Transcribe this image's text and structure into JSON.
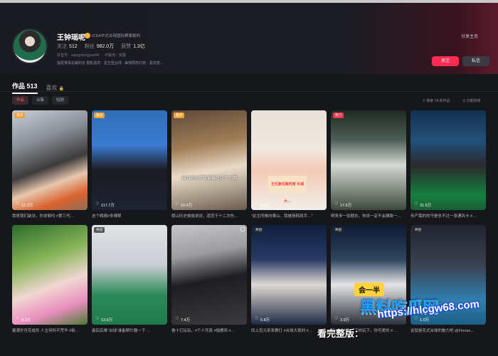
{
  "profile": {
    "name": "王钟瑶呢",
    "verified_text": "ICEA中式台球国际赛事裁判",
    "stats": [
      {
        "label": "关注",
        "value": "512"
      },
      {
        "label": "粉丝",
        "value": "982.0万"
      },
      {
        "label": "获赞",
        "value": "1.3亿"
      }
    ],
    "account_id": "抖音号：wangzhongyao54",
    "ip_location": "IP属地：安徽",
    "bio": "独爱赛事总裁判长 摄影嘉宾 · 星空壹台球 · 美丽照样打枪 · 嘉宾唐…",
    "share_label": "分享主页",
    "follow_label": "关注",
    "message_label": "私信"
  },
  "tabs": {
    "works_label": "作品 513",
    "likes_label": "喜欢",
    "lock_icon": "lock-icon"
  },
  "filters": {
    "chips": [
      "作品",
      "合集",
      "短剧"
    ],
    "search_label": "搜索 TA 的作品",
    "sort_label": "日期排序"
  },
  "videos": [
    {
      "badge": "置顶",
      "likes": "12.3万",
      "caption": "我哥我们敲法，你说够吗 #第三代…"
    },
    {
      "badge": "置顶",
      "likes": "117.7万",
      "caption": "这个姆姆#多裸帮"
    },
    {
      "badge": "置顶",
      "likes": "10.4万",
      "caption": "假山历史偷偷说说，遗恋于十二次伤…",
      "overlay": "自的的东窝背被插在这个上面"
    },
    {
      "badge": "",
      "likes": "2.3万",
      "caption": "\"此生所推向泰山，我摊扬韩就手…\"",
      "overlay": "王氏兼任裁判官 长城大…"
    },
    {
      "badge": "热门",
      "likes": "17.5万",
      "caption": "明来多一张捆去，你说一定不会雅致一…"
    },
    {
      "badge": "",
      "likes": "31.5万",
      "caption": "传产需的的守是总不过一张通风卡 #…"
    },
    {
      "badge": "",
      "likes": "8.2万",
      "caption": "春潮岁月花成形 人生何科不荒华 #新…"
    },
    {
      "badge": "共创",
      "likes": "13.6万",
      "caption": "最后后难\"台球\"谁能帮忙撒一下 …"
    },
    {
      "badge": "",
      "likes": "7.4万",
      "caption": "看十打玩玩。#个人写真 #伽鹿风 #…"
    },
    {
      "badge": "共创",
      "likes": "5.8万",
      "caption": "同上您元来来赛打 #台球大裁判 #…"
    },
    {
      "badge": "共创",
      "likes": "3.9万",
      "caption": "终于和他约好了你玩下，你可爱的 # …"
    },
    {
      "badge": "共创",
      "likes": "1.0万",
      "caption": "这就是花式台球的魅力吧 @Florian…"
    }
  ],
  "watermark": {
    "tag": "会一半",
    "brand": "黑料吃瓜网",
    "url_label": "看完整版：",
    "url": "https://hlcgw68.com"
  }
}
